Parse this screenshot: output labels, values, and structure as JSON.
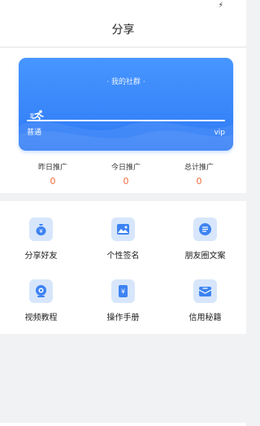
{
  "status": {
    "icon": "charging-icon",
    "glyph": "⚡"
  },
  "header": {
    "title": "分享"
  },
  "card": {
    "title": "· 我的社群 ·",
    "level_left": "普通",
    "level_right": "vip",
    "progress": 0,
    "accent": "#2f7af6"
  },
  "stats": [
    {
      "label": "昨日推广",
      "value": "0"
    },
    {
      "label": "今日推广",
      "value": "0"
    },
    {
      "label": "总计推广",
      "value": "0"
    }
  ],
  "grid": [
    {
      "label": "分享好友",
      "icon": "money-bag-icon"
    },
    {
      "label": "个性签名",
      "icon": "image-icon"
    },
    {
      "label": "朋友圈文案",
      "icon": "list-icon"
    },
    {
      "label": "视频教程",
      "icon": "camera-icon"
    },
    {
      "label": "操作手册",
      "icon": "manual-icon"
    },
    {
      "label": "信用秘籍",
      "icon": "credit-icon"
    }
  ],
  "colors": {
    "stat_value": "#f06b3b",
    "icon_bg": "#d7e6fb",
    "icon_fg": "#3d83f2"
  }
}
